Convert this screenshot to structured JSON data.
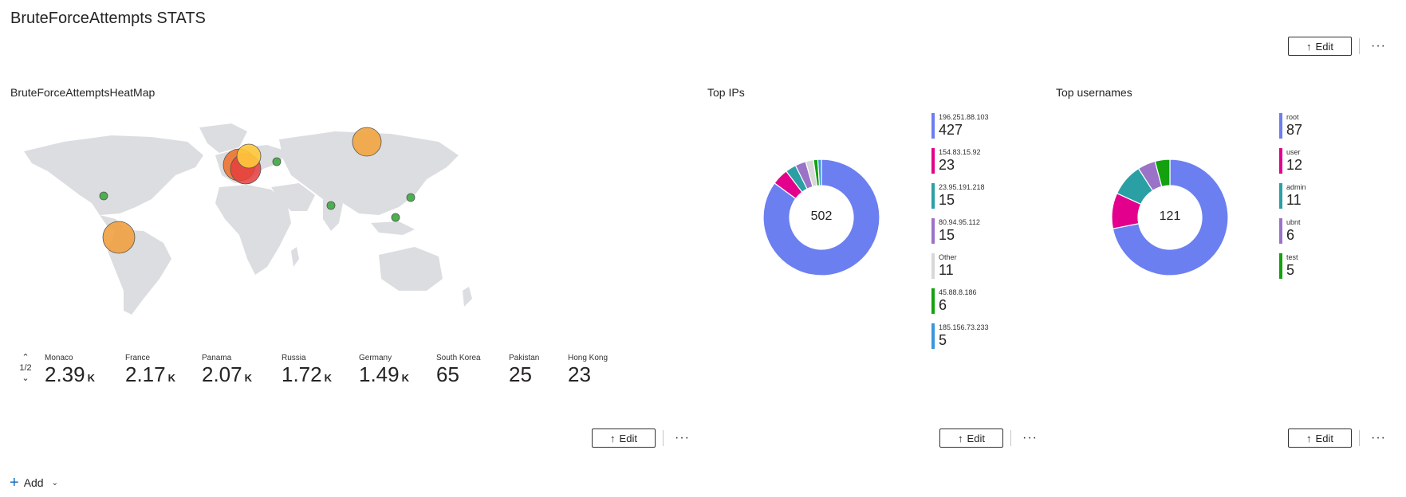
{
  "page": {
    "title": "BruteForceAttempts STATS"
  },
  "toolbar": {
    "edit_label": "Edit",
    "more_label": "···",
    "add_label": "Add"
  },
  "map_panel": {
    "title": "BruteForceAttemptsHeatMap",
    "pager": {
      "text": "1/2"
    },
    "tiles": [
      {
        "label": "Monaco",
        "value": "2.39",
        "unit": "K"
      },
      {
        "label": "France",
        "value": "2.17",
        "unit": "K"
      },
      {
        "label": "Panama",
        "value": "2.07",
        "unit": "K"
      },
      {
        "label": "Russia",
        "value": "1.72",
        "unit": "K"
      },
      {
        "label": "Germany",
        "value": "1.49",
        "unit": "K"
      },
      {
        "label": "South Korea",
        "value": "65",
        "unit": ""
      },
      {
        "label": "Pakistan",
        "value": "25",
        "unit": ""
      },
      {
        "label": "Hong Kong",
        "value": "23",
        "unit": ""
      }
    ]
  },
  "top_ips": {
    "title": "Top IPs",
    "total": "502",
    "items": [
      {
        "label": "196.251.88.103",
        "value": "427",
        "color": "#6b7ff0"
      },
      {
        "label": "154.83.15.92",
        "value": "23",
        "color": "#e3008c"
      },
      {
        "label": "23.95.191.218",
        "value": "15",
        "color": "#2aa0a4"
      },
      {
        "label": "80.94.95.112",
        "value": "15",
        "color": "#9a73c8"
      },
      {
        "label": "Other",
        "value": "11",
        "color": "#d8d8d8"
      },
      {
        "label": "45.88.8.186",
        "value": "6",
        "color": "#13a10e"
      },
      {
        "label": "185.156.73.233",
        "value": "5",
        "color": "#3a96dd"
      }
    ]
  },
  "top_usernames": {
    "title": "Top usernames",
    "total": "121",
    "items": [
      {
        "label": "root",
        "value": "87",
        "color": "#6b7ff0"
      },
      {
        "label": "user",
        "value": "12",
        "color": "#e3008c"
      },
      {
        "label": "admin",
        "value": "11",
        "color": "#2aa0a4"
      },
      {
        "label": "ubnt",
        "value": "6",
        "color": "#9a73c8"
      },
      {
        "label": "test",
        "value": "5",
        "color": "#13a10e"
      }
    ]
  }
}
